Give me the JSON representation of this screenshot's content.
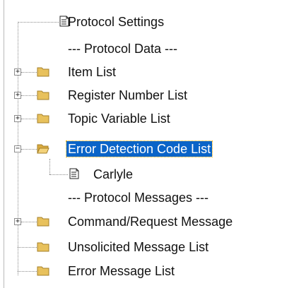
{
  "tree": {
    "items": [
      {
        "label": "Protocol Settings",
        "icon": "document-icon"
      },
      {
        "label": "--- Protocol Data ---",
        "icon": "none"
      },
      {
        "label": "Item List",
        "icon": "folder-icon",
        "expander": "+"
      },
      {
        "label": "Register Number List",
        "icon": "folder-icon",
        "expander": "+"
      },
      {
        "label": "Topic Variable List",
        "icon": "folder-icon",
        "expander": "+"
      },
      {
        "label": "Error Detection Code List",
        "icon": "open-folder-icon",
        "expander": "−",
        "selected": true
      },
      {
        "label": "Carlyle",
        "icon": "document-icon"
      },
      {
        "label": "--- Protocol Messages ---",
        "icon": "none"
      },
      {
        "label": "Command/Request Message",
        "icon": "folder-icon",
        "expander": "+"
      },
      {
        "label": "Unsolicited Message List",
        "icon": "folder-icon"
      },
      {
        "label": "Error Message List",
        "icon": "folder-icon"
      }
    ]
  },
  "colors": {
    "selection_bg": "#0a64c8",
    "selection_text": "#ffffff",
    "folder": "#e8c15c"
  }
}
